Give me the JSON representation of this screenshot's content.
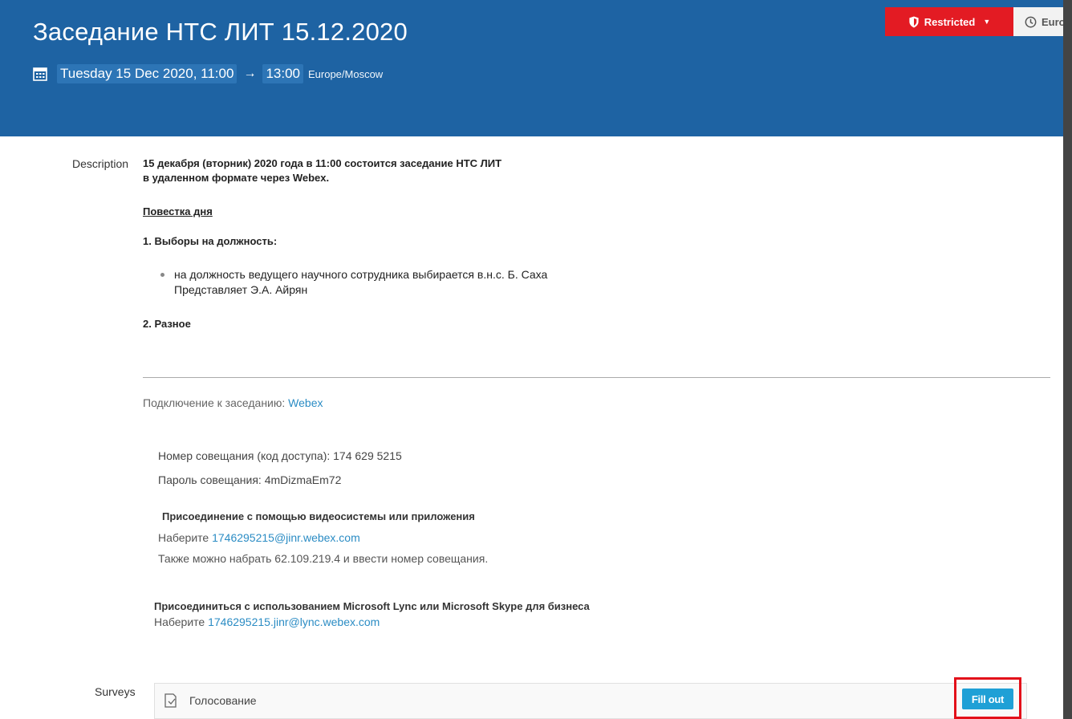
{
  "header": {
    "title": "Заседание НТС ЛИТ 15.12.2020",
    "date_start": "Tuesday 15 Dec 2020, 11:00",
    "arrow": "→",
    "date_end": "13:00",
    "timezone": "Europe/Moscow",
    "restricted_label": "Restricted",
    "timezone_button_label": "Euro"
  },
  "colors": {
    "header_bg": "#1e63a3",
    "restricted_bg": "#e31b23",
    "link": "#2b8cc4",
    "fill_button": "#1fa0d6",
    "highlight_border": "#e3101a"
  },
  "description": {
    "label": "Description",
    "intro_line1": "15 декабря (вторник) 2020 года в 11:00 состоится заседание НТС ЛИТ",
    "intro_line2": "в удаленном формате через Webex.",
    "agenda_title": "Повестка дня",
    "item1": "1.  Выборы на должность:",
    "item1_bullet_line1": "на должность ведущего научного сотрудника выбирается в.н.с. Б. Саха",
    "item1_bullet_line2": "Представляет Э.А. Айрян",
    "item2": "2.  Разное",
    "connect_prefix": "Подключение к заседанию: ",
    "connect_link": "Webex",
    "meeting_number": "Номер совещания (код доступа): 174 629 5215",
    "meeting_password": "Пароль совещания: 4mDizmaEm72",
    "join_video_title": "Присоединение с помощью видеосистемы или приложения",
    "join_video_prefix": "Наберите ",
    "join_video_link": "1746295215@jinr.webex.com",
    "join_video_alt": "Также можно набрать 62.109.219.4 и ввести номер совещания.",
    "join_lync_title": "Присоединиться с использованием Microsoft Lync или Microsoft Skype для бизнеса",
    "join_lync_prefix": "Наберите ",
    "join_lync_link": "1746295215.jinr@lync.webex.com"
  },
  "surveys": {
    "label": "Surveys",
    "items": [
      {
        "name": "Голосование",
        "action_label": "Fill out"
      }
    ]
  },
  "icons": {
    "calendar": "calendar-icon",
    "shield": "shield-icon",
    "clock": "clock-icon",
    "survey": "survey-icon"
  }
}
